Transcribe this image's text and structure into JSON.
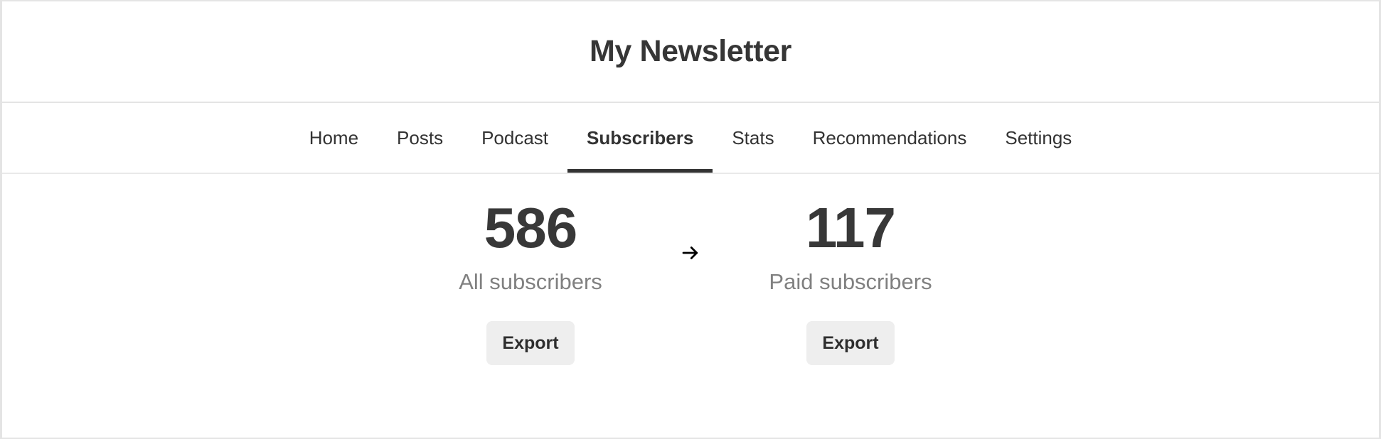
{
  "header": {
    "publication_title": "My Newsletter"
  },
  "nav": {
    "tabs": [
      {
        "label": "Home",
        "active": false
      },
      {
        "label": "Posts",
        "active": false
      },
      {
        "label": "Podcast",
        "active": false
      },
      {
        "label": "Subscribers",
        "active": true
      },
      {
        "label": "Stats",
        "active": false
      },
      {
        "label": "Recommendations",
        "active": false
      },
      {
        "label": "Settings",
        "active": false
      }
    ]
  },
  "main": {
    "stats": [
      {
        "value": "586",
        "label": "All subscribers",
        "export_label": "Export"
      },
      {
        "value": "117",
        "label": "Paid subscribers",
        "export_label": "Export"
      }
    ],
    "separator_icon": "arrow-right-icon",
    "separator_glyph": "→"
  },
  "colors": {
    "text_primary": "#333333",
    "text_muted": "#808080",
    "stat_number": "#383838",
    "border": "#e4e4e4",
    "button_bg": "#eeeeee",
    "active_indicator": "#333333"
  }
}
